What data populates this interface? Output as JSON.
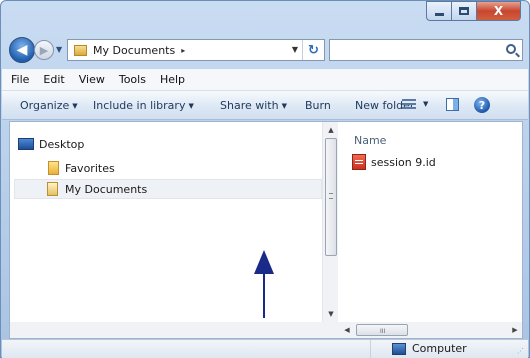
{
  "window": {
    "caption": {
      "close_glyph": "X"
    }
  },
  "nav": {
    "address": "My Documents",
    "address_separator": "▸",
    "search_placeholder": ""
  },
  "menu": {
    "items": [
      "File",
      "Edit",
      "View",
      "Tools",
      "Help"
    ]
  },
  "toolbar": {
    "organize": "Organize",
    "include_in_library": "Include in library",
    "share_with": "Share with",
    "burn": "Burn",
    "new_folder": "New folder"
  },
  "tree": {
    "items": [
      {
        "label": "Desktop",
        "icon": "desktop-icon"
      },
      {
        "label": "Favorites",
        "icon": "favorites-star-icon"
      },
      {
        "label": "My Documents",
        "icon": "documents-icon"
      }
    ]
  },
  "files": {
    "column_name": "Name",
    "items": [
      {
        "label": "session 9.id",
        "icon": "indesign-file-icon"
      }
    ]
  },
  "scrollbars": {
    "h_grip": "III"
  },
  "status": {
    "location": "Computer"
  },
  "colors": {
    "annotation_arrow": "#1a2a88",
    "close_button": "#c6472f",
    "selection": "#eef1f5"
  }
}
